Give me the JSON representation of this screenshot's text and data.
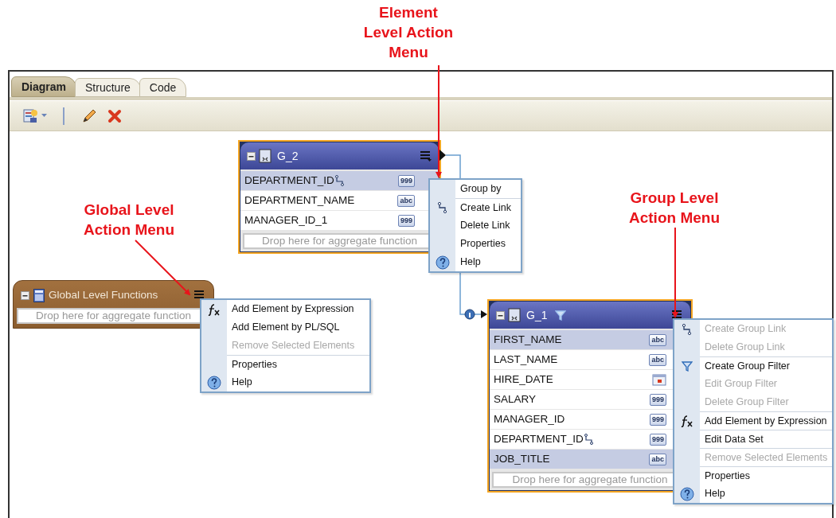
{
  "annotations": [
    {
      "kind": "element",
      "text": "Element\nLevel Action\nMenu"
    },
    {
      "kind": "global",
      "text": "Global Level\nAction Menu"
    },
    {
      "kind": "group",
      "text": "Group Level\nAction Menu"
    }
  ],
  "tabs": [
    {
      "label": "Diagram",
      "selected": true
    },
    {
      "label": "Structure",
      "selected": false
    },
    {
      "label": "Code",
      "selected": false
    }
  ],
  "groups": [
    {
      "kind": "group",
      "title": "G_2",
      "filter": false,
      "drop_placeholder": "Drop here for aggregate function",
      "elements": [
        {
          "name": "DEPARTMENT_ID",
          "kind": "badge",
          "badge": "999",
          "link": true,
          "selected": true
        },
        {
          "name": "DEPARTMENT_NAME",
          "kind": "badge",
          "badge": "abc",
          "link": false,
          "selected": false
        },
        {
          "name": "MANAGER_ID_1",
          "kind": "badge",
          "badge": "999",
          "link": false,
          "selected": false
        }
      ],
      "menu": [
        {
          "label": "Group by",
          "kind": "plain",
          "disabled": false,
          "separated": false
        },
        {
          "label": "Create Link",
          "kind": "link",
          "disabled": false,
          "separated": true
        },
        {
          "label": "Delete Link",
          "kind": "plain",
          "disabled": false,
          "separated": false
        },
        {
          "label": "Properties",
          "kind": "plain",
          "disabled": false,
          "separated": false
        },
        {
          "label": "Help",
          "kind": "help",
          "disabled": false,
          "separated": false
        }
      ]
    },
    {
      "kind": "global",
      "title": "Global Level Functions",
      "drop_placeholder": "Drop here for aggregate function",
      "menu": [
        {
          "label": "Add Element by Expression",
          "kind": "fx",
          "disabled": false,
          "separated": false
        },
        {
          "label": "Add Element by PL/SQL",
          "kind": "plain",
          "disabled": false,
          "separated": false
        },
        {
          "label": "Remove Selected Elements",
          "kind": "plain",
          "disabled": true,
          "separated": false
        },
        {
          "label": "Properties",
          "kind": "plain",
          "disabled": false,
          "separated": true
        },
        {
          "label": "Help",
          "kind": "help",
          "disabled": false,
          "separated": false
        }
      ]
    },
    {
      "kind": "group",
      "title": "G_1",
      "filter": true,
      "drop_placeholder": "Drop here for aggregate function",
      "elements": [
        {
          "name": "FIRST_NAME",
          "kind": "badge",
          "badge": "abc",
          "link": false,
          "selected": true
        },
        {
          "name": "LAST_NAME",
          "kind": "badge",
          "badge": "abc",
          "link": false,
          "selected": false
        },
        {
          "name": "HIRE_DATE",
          "kind": "date",
          "link": false,
          "selected": false
        },
        {
          "name": "SALARY",
          "kind": "badge",
          "badge": "999",
          "link": false,
          "selected": false
        },
        {
          "name": "MANAGER_ID",
          "kind": "badge",
          "badge": "999",
          "link": false,
          "selected": false
        },
        {
          "name": "DEPARTMENT_ID",
          "kind": "badge",
          "badge": "999",
          "link": true,
          "selected": false
        },
        {
          "name": "JOB_TITLE",
          "kind": "badge",
          "badge": "abc",
          "link": false,
          "selected": true
        }
      ],
      "menu": [
        {
          "label": "Create Group Link",
          "kind": "link",
          "disabled": true,
          "separated": false
        },
        {
          "label": "Delete Group Link",
          "kind": "plain",
          "disabled": true,
          "separated": false
        },
        {
          "label": "Create Group Filter",
          "kind": "filter",
          "disabled": false,
          "separated": true
        },
        {
          "label": "Edit Group Filter",
          "kind": "plain",
          "disabled": true,
          "separated": false
        },
        {
          "label": "Delete Group Filter",
          "kind": "plain",
          "disabled": true,
          "separated": false
        },
        {
          "label": "Add Element by Expression",
          "kind": "fx",
          "disabled": false,
          "separated": true
        },
        {
          "label": "Edit Data Set",
          "kind": "plain",
          "disabled": false,
          "separated": true
        },
        {
          "label": "Remove Selected Elements",
          "kind": "plain",
          "disabled": true,
          "separated": true
        },
        {
          "label": "Properties",
          "kind": "plain",
          "disabled": false,
          "separated": true
        },
        {
          "label": "Help",
          "kind": "help",
          "disabled": false,
          "separated": false
        }
      ]
    }
  ]
}
